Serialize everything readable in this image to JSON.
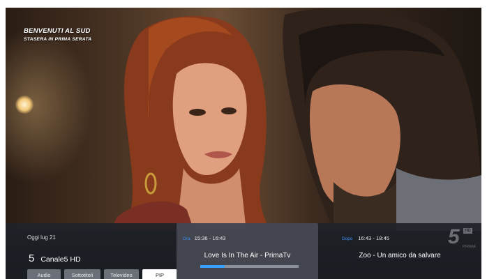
{
  "promo": {
    "line1": "BENVENUTI AL SUD",
    "line2": "STASERA IN PRIMA SERATA"
  },
  "info": {
    "date": "Oggi lug 21",
    "channel_number": "5",
    "channel_name": "Canale5 HD",
    "buttons": [
      {
        "label": "Audio",
        "active": false
      },
      {
        "label": "Sottotitoli",
        "active": false
      },
      {
        "label": "Televideo",
        "active": false
      },
      {
        "label": "PIP",
        "active": true
      }
    ]
  },
  "now": {
    "tag": "Ora",
    "time": "15:36 - 16:43",
    "title": "Love Is In The Air - PrimaTv",
    "progress_percent": 25
  },
  "next": {
    "tag": "Dopo",
    "time": "16:43 - 18:45",
    "title": "Zoo - Un amico da salvare"
  },
  "watermark": {
    "digit": "5",
    "badge": "HD",
    "sub": "PRIMA"
  },
  "colors": {
    "accent": "#3e8ff5",
    "progress_fill": "#3aa0ff",
    "bar_bg": "#1e2228",
    "active_button": "#ffffff"
  },
  "icons": {
    "channel_logo": "canale5-logo-watermark"
  }
}
